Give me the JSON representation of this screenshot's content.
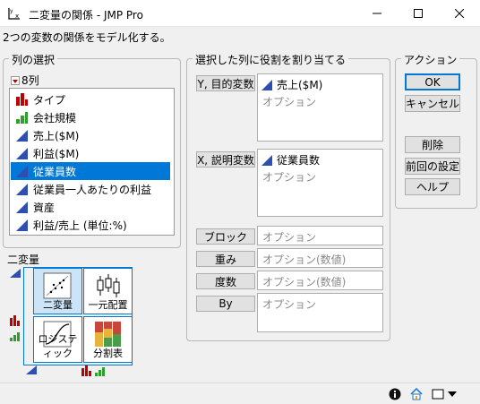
{
  "window": {
    "title": "二変量の関係 - JMP Pro",
    "subtitle": "2つの変数の関係をモデル化する。"
  },
  "columns_panel": {
    "legend": "列の選択",
    "count_label": "8列",
    "items": [
      {
        "label": "タイプ",
        "icon": "nominal-bar-icon"
      },
      {
        "label": "会社規模",
        "icon": "ordinal-bar-icon"
      },
      {
        "label": "売上($M)",
        "icon": "continuous-triangle-icon"
      },
      {
        "label": "利益($M)",
        "icon": "continuous-triangle-icon"
      },
      {
        "label": "従業員数",
        "icon": "continuous-triangle-icon"
      },
      {
        "label": "従業員一人あたりの利益",
        "icon": "continuous-triangle-icon"
      },
      {
        "label": "資産",
        "icon": "continuous-triangle-icon"
      },
      {
        "label": "利益/売上 (単位:%)",
        "icon": "continuous-triangle-icon"
      }
    ],
    "selected_index": 4
  },
  "bivariate_panel": {
    "label": "二変量",
    "buttons": [
      {
        "label": "二変量"
      },
      {
        "label": "一元配置"
      },
      {
        "label": "ロジスティック"
      },
      {
        "label": "分割表"
      }
    ]
  },
  "roles_panel": {
    "legend": "選択した列に役割を割り当てる",
    "y": {
      "button": "Y, 目的変数",
      "value": "売上($M)",
      "placeholder": "オプション"
    },
    "x": {
      "button": "X, 説明変数",
      "value": "従業員数",
      "placeholder": "オプション"
    },
    "block": {
      "button": "ブロック",
      "placeholder": "オプション"
    },
    "weight": {
      "button": "重み",
      "placeholder": "オプション(数値)"
    },
    "freq": {
      "button": "度数",
      "placeholder": "オプション(数値)"
    },
    "by": {
      "button": "By",
      "placeholder": "オプション"
    }
  },
  "actions_panel": {
    "legend": "アクション",
    "ok": "OK",
    "cancel": "キャンセル",
    "remove": "削除",
    "recall": "前回の設定",
    "help": "ヘルプ"
  },
  "colors": {
    "accent": "#0078d7",
    "nominal": "#c00000",
    "ordinal": "#2e9e2e",
    "continuous": "#2f4fb0"
  }
}
